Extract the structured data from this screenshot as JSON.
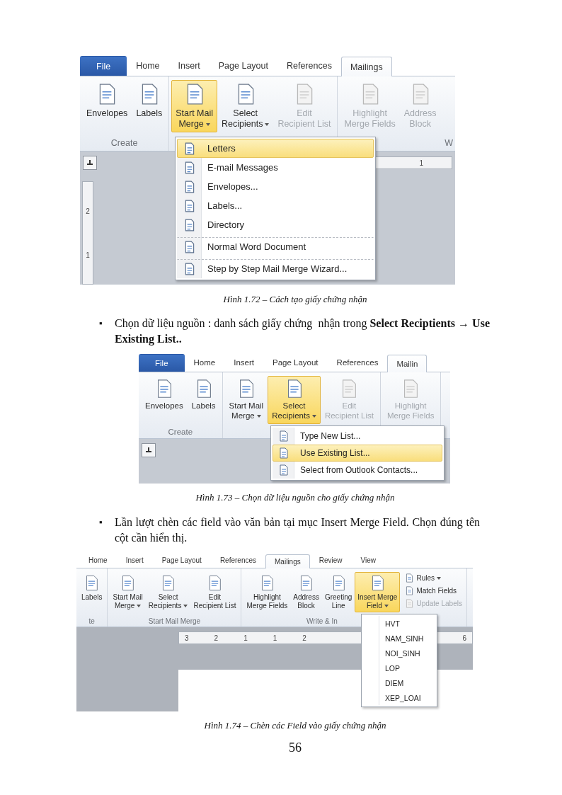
{
  "blocks": [
    {
      "kind": "figure",
      "tabs": [
        {
          "label": "File",
          "kind": "file",
          "selected": false
        },
        {
          "label": "Home",
          "kind": "tab",
          "selected": false
        },
        {
          "label": "Insert",
          "kind": "tab",
          "selected": false
        },
        {
          "label": "Page Layout",
          "kind": "tab",
          "selected": false
        },
        {
          "label": "References",
          "kind": "tab",
          "selected": false
        },
        {
          "label": "Mailings",
          "kind": "tab",
          "selected": true
        }
      ],
      "groups": [
        {
          "label": "Create",
          "buttons": [
            {
              "lines": [
                "Envelopes"
              ],
              "dropdown": false,
              "disabled": false,
              "selected": false
            },
            {
              "lines": [
                "Labels"
              ],
              "dropdown": false,
              "disabled": false,
              "selected": false
            }
          ]
        },
        {
          "buttons": [
            {
              "lines": [
                "Start Mail",
                "Merge"
              ],
              "dropdown": true,
              "disabled": false,
              "selected": true
            },
            {
              "lines": [
                "Select",
                "Recipients"
              ],
              "dropdown": true,
              "disabled": false,
              "selected": false
            },
            {
              "lines": [
                "Edit",
                "Recipient List"
              ],
              "dropdown": false,
              "disabled": true,
              "selected": false
            }
          ]
        },
        {
          "label": "W",
          "cut_right": true,
          "buttons": [
            {
              "lines": [
                "Highlight",
                "Merge Fields"
              ],
              "dropdown": false,
              "disabled": true,
              "selected": false
            },
            {
              "lines": [
                "Address",
                "Block"
              ],
              "dropdown": false,
              "disabled": true,
              "selected": false
            }
          ]
        }
      ],
      "menu": {
        "with_icons": true,
        "items": [
          {
            "label": "Letters",
            "selected": true,
            "separator": false
          },
          {
            "label": "E-mail Messages",
            "selected": false,
            "separator": false
          },
          {
            "label": "Envelopes...",
            "selected": false,
            "separator": false
          },
          {
            "label": "Labels...",
            "selected": false,
            "separator": false
          },
          {
            "label": "Directory",
            "selected": false,
            "separator": false
          },
          {
            "label": "Normal Word Document",
            "selected": false,
            "separator": true
          },
          {
            "label": "Step by Step Mail Merge Wizard...",
            "selected": false,
            "separator": true
          }
        ]
      },
      "document": {
        "tab_selector": true,
        "ruler_labels": [
          "1"
        ],
        "vertical_ruler_labels": [
          "2",
          "1"
        ],
        "page": false
      }
    },
    {
      "kind": "caption",
      "text": "Hình 1.72 – Cách tạo giấy chứng nhận"
    },
    {
      "kind": "bullet",
      "marker": "▪",
      "text": "Chọn dữ liệu nguồn : danh sách giấy chứng  nhận trong **Select Reciptients → Use Existing List..**"
    },
    {
      "kind": "figure",
      "tabs": [
        {
          "label": "File",
          "kind": "file",
          "selected": false
        },
        {
          "label": "Home",
          "kind": "tab",
          "selected": false
        },
        {
          "label": "Insert",
          "kind": "tab",
          "selected": false
        },
        {
          "label": "Page Layout",
          "kind": "tab",
          "selected": false
        },
        {
          "label": "References",
          "kind": "tab",
          "selected": false
        },
        {
          "label": "Mailin",
          "kind": "tab",
          "selected": true
        }
      ],
      "groups": [
        {
          "label": "Create",
          "buttons": [
            {
              "lines": [
                "Envelopes"
              ],
              "dropdown": false,
              "disabled": false,
              "selected": false
            },
            {
              "lines": [
                "Labels"
              ],
              "dropdown": false,
              "disabled": false,
              "selected": false
            }
          ]
        },
        {
          "buttons": [
            {
              "lines": [
                "Start Mail",
                "Merge"
              ],
              "dropdown": true,
              "disabled": false,
              "selected": false
            },
            {
              "lines": [
                "Select",
                "Recipients"
              ],
              "dropdown": true,
              "disabled": false,
              "selected": true
            },
            {
              "lines": [
                "Edit",
                "Recipient List"
              ],
              "dropdown": false,
              "disabled": true,
              "selected": false
            }
          ]
        },
        {
          "buttons": [
            {
              "lines": [
                "Highlight",
                "Merge Fields"
              ],
              "dropdown": false,
              "disabled": true,
              "selected": false
            }
          ]
        }
      ],
      "menu": {
        "with_icons": true,
        "items": [
          {
            "label": "Type New List...",
            "selected": false
          },
          {
            "label": "Use Existing List...",
            "selected": true
          },
          {
            "label": "Select from Outlook Contacts...",
            "selected": false
          }
        ]
      },
      "document": {
        "tab_selector": true,
        "page": false
      }
    },
    {
      "kind": "caption",
      "text": "Hình 1.73 – Chọn dữ liệu nguồn cho giấy chứng nhận"
    },
    {
      "kind": "bullet",
      "marker": "▪",
      "text": "Lần lượt chèn các field vào văn bản tại mục Insert Merge Field. Chọn đúng tên cột cần hiển thị."
    },
    {
      "kind": "figure",
      "tabs": [
        {
          "label": "Home",
          "kind": "tab",
          "selected": false
        },
        {
          "label": "Insert",
          "kind": "tab",
          "selected": false
        },
        {
          "label": "Page Layout",
          "kind": "tab",
          "selected": false
        },
        {
          "label": "References",
          "kind": "tab",
          "selected": false
        },
        {
          "label": "Mailings",
          "kind": "tab",
          "selected": true
        },
        {
          "label": "Review",
          "kind": "tab",
          "selected": false
        },
        {
          "label": "View",
          "kind": "tab",
          "selected": false
        }
      ],
      "groups": [
        {
          "label": "te",
          "buttons": [
            {
              "lines": [
                "Labels"
              ],
              "dropdown": false,
              "disabled": false,
              "selected": false
            }
          ]
        },
        {
          "label": "Start Mail Merge",
          "buttons": [
            {
              "lines": [
                "Start Mail",
                "Merge"
              ],
              "dropdown": true,
              "disabled": false,
              "selected": false
            },
            {
              "lines": [
                "Select",
                "Recipients"
              ],
              "dropdown": true,
              "disabled": false,
              "selected": false
            },
            {
              "lines": [
                "Edit",
                "Recipient List"
              ],
              "dropdown": false,
              "disabled": false,
              "selected": false
            }
          ]
        },
        {
          "label": "Write & In",
          "buttons": [
            {
              "lines": [
                "Highlight",
                "Merge Fields"
              ],
              "dropdown": false,
              "disabled": false,
              "selected": false
            },
            {
              "lines": [
                "Address",
                "Block"
              ],
              "dropdown": false,
              "disabled": false,
              "selected": false
            },
            {
              "lines": [
                "Greeting",
                "Line"
              ],
              "dropdown": false,
              "disabled": false,
              "selected": false
            },
            {
              "lines": [
                "Insert Merge",
                "Field"
              ],
              "dropdown": true,
              "disabled": false,
              "selected": true
            }
          ],
          "small_buttons": [
            {
              "label": "Rules",
              "dropdown": true,
              "disabled": false,
              "selected": false
            },
            {
              "label": "Match Fields",
              "dropdown": false,
              "disabled": false,
              "selected": false
            },
            {
              "label": "Update Labels",
              "dropdown": false,
              "disabled": true,
              "selected": false
            }
          ]
        }
      ],
      "menu": {
        "with_icons": false,
        "items": [
          {
            "label": "HVT",
            "selected": false
          },
          {
            "label": "NAM_SINH",
            "selected": false
          },
          {
            "label": "NOI_SINH",
            "selected": false
          },
          {
            "label": "LOP",
            "selected": false
          },
          {
            "label": "DIEM",
            "selected": false
          },
          {
            "label": "XEP_LOAI",
            "selected": false
          }
        ]
      },
      "document": {
        "tab_selector": false,
        "ruler_labels": [
          "3",
          "2",
          "1",
          "1",
          "2",
          "6"
        ],
        "page": true
      }
    },
    {
      "kind": "caption",
      "text": "Hình 1.74 – Chèn các Field vào giấy chứng nhận"
    },
    {
      "kind": "page_number",
      "text": "56"
    }
  ]
}
